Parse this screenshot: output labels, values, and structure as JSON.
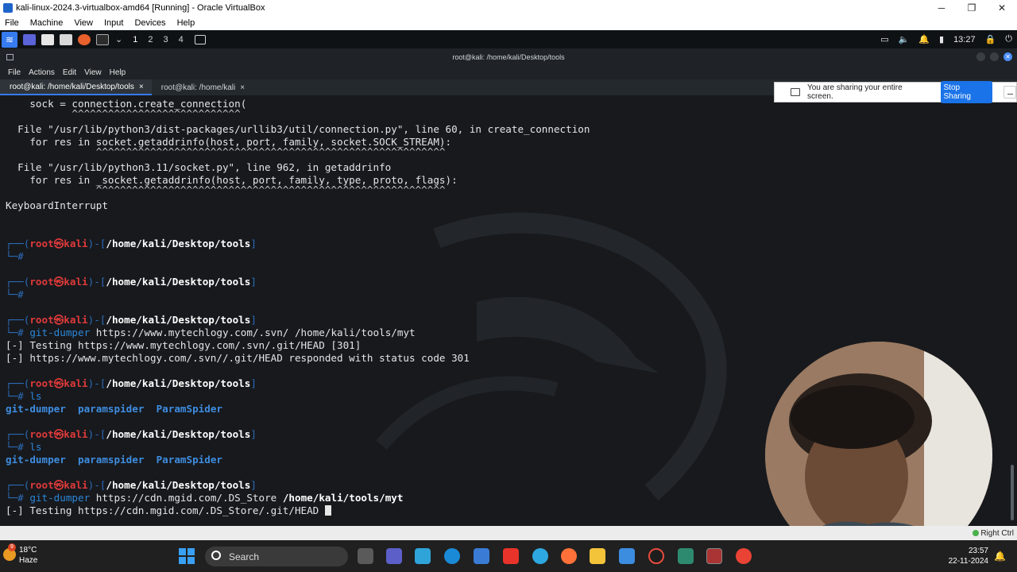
{
  "host_window": {
    "title": "kali-linux-2024.3-virtualbox-amd64 [Running] - Oracle VirtualBox",
    "menu": [
      "File",
      "Machine",
      "View",
      "Input",
      "Devices",
      "Help"
    ],
    "controls": {
      "minimize": "─",
      "maximize": "❐",
      "close": "✕"
    }
  },
  "kali_panel": {
    "workspaces": [
      "1",
      "2",
      "3",
      "4"
    ],
    "clock": "13:27"
  },
  "terminal_window": {
    "title": "root@kali: /home/kali/Desktop/tools",
    "menu": [
      "File",
      "Actions",
      "Edit",
      "View",
      "Help"
    ],
    "tabs": [
      {
        "label": "root@kali: /home/kali/Desktop/tools",
        "close": "×"
      },
      {
        "label": "root@kali: /home/kali",
        "close": "×"
      }
    ]
  },
  "share_banner": {
    "message": "You are sharing your entire screen.",
    "button": "Stop Sharing"
  },
  "terminal_lines": {
    "l1": "    sock = connection.create_connection(",
    "l2": "           ^^^^^^^^^^^^^^^^^^^^^^^^^^^^",
    "l3": "  File \"/usr/lib/python3/dist-packages/urllib3/util/connection.py\", line 60, in create_connection",
    "l4": "    for res in socket.getaddrinfo(host, port, family, socket.SOCK_STREAM):",
    "l5": "               ^^^^^^^^^^^^^^^^^^^^^^^^^^^^^^^^^^^^^^^^^^^^^^^^^^^^^^^^^^",
    "l6": "  File \"/usr/lib/python3.11/socket.py\", line 962, in getaddrinfo",
    "l7": "    for res in _socket.getaddrinfo(host, port, family, type, proto, flags):",
    "l8": "               ^^^^^^^^^^^^^^^^^^^^^^^^^^^^^^^^^^^^^^^^^^^^^^^^^^^^^^^^^^",
    "l9": "KeyboardInterrupt",
    "cmd_gitdumper_1": "https://www.mytechlogy.com/.svn/ /home/kali/tools/myt",
    "out_1": "[-] Testing https://www.mytechlogy.com/.svn/.git/HEAD [301]",
    "out_2": "[-] https://www.mytechlogy.com/.svn//.git/HEAD responded with status code 301",
    "cmd_gitdumper_2_url": "https://cdn.mgid.com/.DS_Store",
    "cmd_gitdumper_2_path": "/home/kali/tools/myt",
    "out_3": "[-] Testing https://cdn.mgid.com/.DS_Store/.git/HEAD "
  },
  "prompt": {
    "open": "┌──(",
    "user": "root",
    "at": "㉿",
    "host": "kali",
    "mid": ")-[",
    "path": "/home/kali/Desktop/tools",
    "close": "]",
    "hash": "└─#"
  },
  "commands": {
    "git_dumper": "git-dumper",
    "ls": "ls"
  },
  "ls_output": [
    "git-dumper",
    "paramspider",
    "ParamSpider"
  ],
  "vbox_status": {
    "host_key": "Right Ctrl"
  },
  "taskbar": {
    "weather_temp": "18°C",
    "weather_desc": "Haze",
    "weather_badge": "9",
    "search_placeholder": "Search",
    "time": "23:57",
    "date": "22-11-2024"
  },
  "colors": {
    "prompt_blue": "#2d6cb9",
    "root_red": "#e03a3a",
    "dir_blue": "#3f8de0",
    "accent": "#367bf0"
  }
}
